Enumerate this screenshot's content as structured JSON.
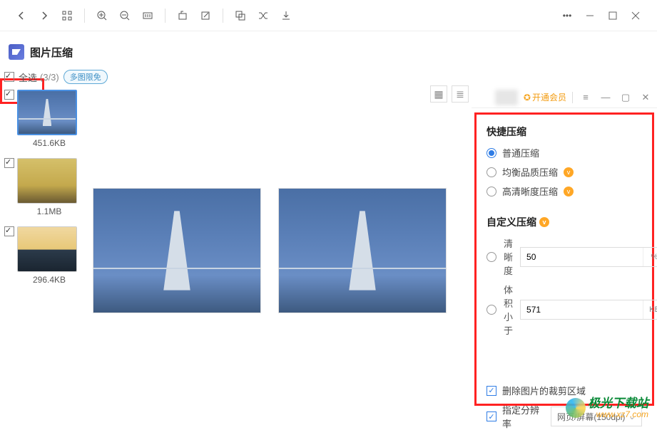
{
  "app": {
    "title": "图片压缩"
  },
  "toolbar_icons": [
    "back",
    "forward",
    "grid",
    "zoom-in",
    "zoom-out",
    "actual-size",
    "rotate",
    "edit",
    "resize",
    "random",
    "download",
    "more",
    "minimize",
    "maximize",
    "close"
  ],
  "selectAll": {
    "label": "全选",
    "count": "(3/3)",
    "multi": "多图限免"
  },
  "thumbs": [
    {
      "size": "451.6KB",
      "checked": true,
      "selected": true,
      "kind": "bridge"
    },
    {
      "size": "1.1MB",
      "checked": true,
      "selected": false,
      "kind": "city"
    },
    {
      "size": "296.4KB",
      "checked": true,
      "selected": false,
      "kind": "coast"
    }
  ],
  "rightHeader": {
    "vip": "开通会员"
  },
  "quick": {
    "title": "快捷压缩",
    "options": [
      "普通压缩",
      "均衡品质压缩",
      "高清晰度压缩"
    ],
    "selected": 0
  },
  "custom": {
    "title": "自定义压缩",
    "clarity": {
      "label": "清晰度",
      "value": "50",
      "unit": "%"
    },
    "size": {
      "label": "体积小于",
      "value": "571",
      "unit": "KB"
    }
  },
  "checks": {
    "deleteCrop": "删除图片的裁剪区域",
    "setDpi": "指定分辨率",
    "dpiValue": "网页/屏幕(150dpi)"
  },
  "wm": {
    "l1": "极光下载站",
    "l2": "www.xz7.com"
  }
}
